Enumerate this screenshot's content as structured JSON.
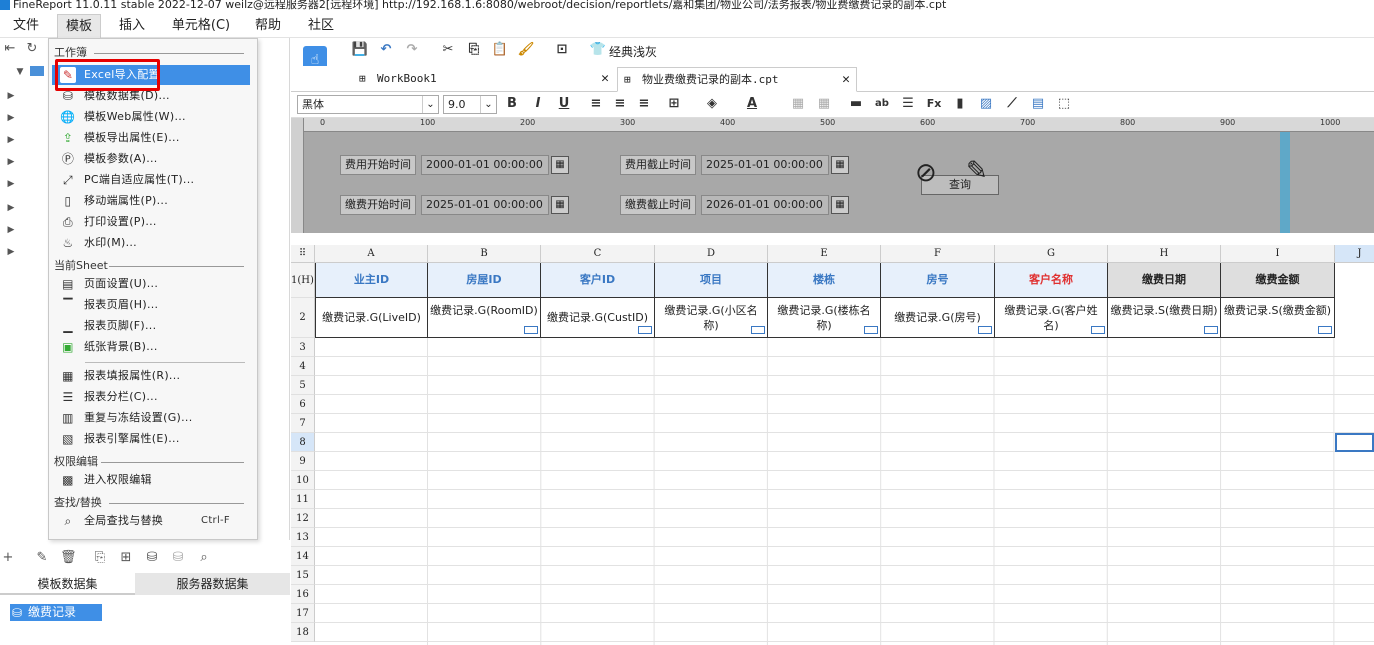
{
  "titlebar": {
    "text": "FineReport 11.0.11 stable 2022-12-07 weilz@远程服务器2[远程环境]     http://192.168.1.6:8080/webroot/decision/reportlets/嘉和集团/物业公司/法务报表/物业费缴费记录的副本.cpt"
  },
  "menubar": {
    "items": [
      "文件",
      "模板",
      "插入",
      "单元格(C)",
      "帮助",
      "社区"
    ]
  },
  "dropdown": {
    "sections": {
      "workbook": "工作簿",
      "current_sheet": "当前Sheet",
      "permission": "权限编辑",
      "find": "查找/替换"
    },
    "workbook_items": [
      "Excel导入配置",
      "模板数据集(D)...",
      "模板Web属性(W)...",
      "模板导出属性(E)...",
      "模板参数(A)...",
      "PC端自适应属性(T)...",
      "移动端属性(P)...",
      "打印设置(P)...",
      "水印(M)..."
    ],
    "sheet_items_a": [
      "页面设置(U)...",
      "报表页眉(H)...",
      "报表页脚(F)...",
      "纸张背景(B)..."
    ],
    "sheet_items_b": [
      "报表填报属性(R)...",
      "报表分栏(C)...",
      "重复与冻结设置(G)...",
      "报表引擎属性(E)..."
    ],
    "permission_item": "进入权限编辑",
    "find_item": "全局查找与替换",
    "find_shortcut": "Ctrl-F"
  },
  "left_panel": {
    "tabs": [
      "模板数据集",
      "服务器数据集"
    ],
    "dataset_item": "缴费记录"
  },
  "toolbar1": {
    "theme_label": "经典浅灰"
  },
  "tabs": [
    {
      "label": "WorkBook1"
    },
    {
      "label": "物业费缴费记录的副本.cpt"
    }
  ],
  "toolbar2": {
    "font": "黑体",
    "size": "9.0"
  },
  "ruler_ticks": [
    "0",
    "100",
    "200",
    "300",
    "400",
    "500",
    "600",
    "700",
    "800",
    "900",
    "1000"
  ],
  "params": [
    {
      "label": "费用开始时间",
      "value": "2000-01-01 00:00:00"
    },
    {
      "label": "费用截止时间",
      "value": "2025-01-01 00:00:00"
    },
    {
      "label": "缴费开始时间",
      "value": "2025-01-01 00:00:00"
    },
    {
      "label": "缴费截止时间",
      "value": "2026-01-01 00:00:00"
    }
  ],
  "query_button": "查询",
  "grid": {
    "columns": [
      "A",
      "B",
      "C",
      "D",
      "E",
      "F",
      "G",
      "H",
      "I",
      "J"
    ],
    "row1_label": "1(H)",
    "rows": [
      "2",
      "3",
      "4",
      "5",
      "6",
      "7",
      "8",
      "9",
      "10",
      "11",
      "12",
      "13",
      "14",
      "15",
      "16",
      "17",
      "18"
    ],
    "headers": [
      "业主ID",
      "房屋ID",
      "客户ID",
      "项目",
      "楼栋",
      "房号",
      "客户名称",
      "缴费日期",
      "缴费金额"
    ],
    "data": [
      "缴费记录.G(LiveID)",
      "缴费记录.G(RoomID)",
      "缴费记录.G(CustID)",
      "缴费记录.G(小区名称)",
      "缴费记录.G(楼栋名称)",
      "缴费记录.G(房号)",
      "缴费记录.G(客户姓名)",
      "缴费记录.S(缴费日期)",
      "缴费记录.S(缴费金额)"
    ]
  },
  "colors": {
    "highlight": "#3f8fe6",
    "red_box": "#e60000",
    "header_blue": "#3a78c3",
    "header_red": "#e03030"
  }
}
